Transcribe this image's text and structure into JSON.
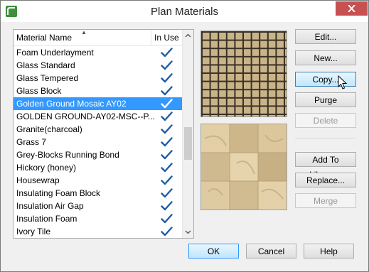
{
  "window": {
    "title": "Plan Materials",
    "close_label": "✕"
  },
  "list": {
    "columns": {
      "name": "Material Name",
      "in_use": "In Use"
    },
    "selected_index": 4,
    "items": [
      {
        "name": "Foam Underlayment",
        "in_use": true
      },
      {
        "name": "Glass  Standard",
        "in_use": true
      },
      {
        "name": "Glass  Tempered",
        "in_use": true
      },
      {
        "name": "Glass Block",
        "in_use": true
      },
      {
        "name": "Golden Ground Mosaic AY02",
        "in_use": true
      },
      {
        "name": "GOLDEN GROUND-AY02-MSC--P...",
        "in_use": true
      },
      {
        "name": "Granite(charcoal)",
        "in_use": true
      },
      {
        "name": "Grass 7",
        "in_use": true
      },
      {
        "name": "Grey-Blocks Running Bond",
        "in_use": true
      },
      {
        "name": "Hickory (honey)",
        "in_use": true
      },
      {
        "name": "Housewrap",
        "in_use": true
      },
      {
        "name": "Insulating Foam Block",
        "in_use": true
      },
      {
        "name": "Insulation  Air Gap",
        "in_use": true
      },
      {
        "name": "Insulation  Foam",
        "in_use": true
      },
      {
        "name": "Ivory Tile",
        "in_use": true
      }
    ]
  },
  "buttons": {
    "edit": "Edit...",
    "new": "New...",
    "copy": "Copy...",
    "purge": "Purge",
    "delete": "Delete",
    "add_to_library": "Add To Library...",
    "replace": "Replace...",
    "merge": "Merge",
    "ok": "OK",
    "cancel": "Cancel",
    "help": "Help"
  },
  "colors": {
    "selection": "#3399ff",
    "check": "#1e5aa8",
    "tile": "#c9b48a",
    "grout": "#3a3024",
    "close": "#c75050"
  }
}
